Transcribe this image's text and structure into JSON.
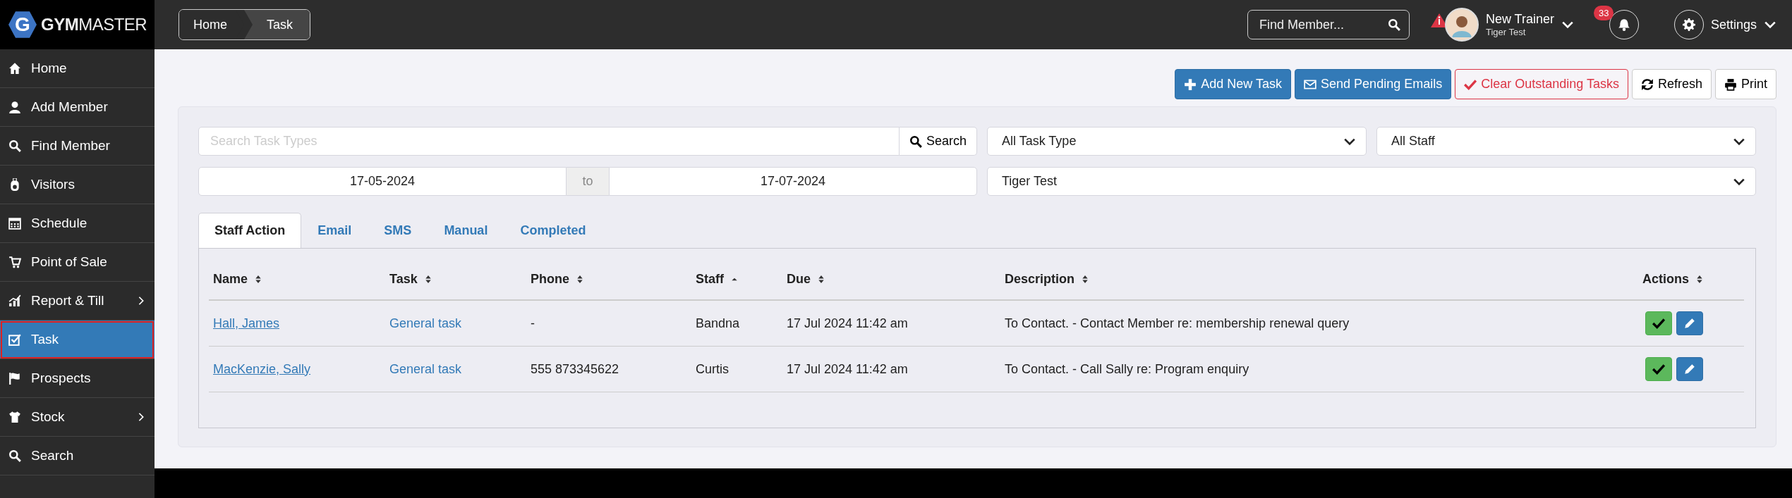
{
  "logo": {
    "mark": "G",
    "text": "**GYM**MASTER"
  },
  "breadcrumb": [
    "Home",
    "Task"
  ],
  "header": {
    "search": {
      "placeholder": "Find Member..."
    },
    "user": {
      "name": "New Trainer",
      "subtitle": "Tiger Test"
    },
    "notifications": {
      "count": "33"
    },
    "settings": {
      "label": "Settings"
    }
  },
  "sidebar": {
    "items": [
      {
        "label": "Home",
        "selected": false,
        "submenu": false
      },
      {
        "label": "Add Member",
        "selected": false,
        "submenu": false
      },
      {
        "label": "Find Member",
        "selected": false,
        "submenu": false
      },
      {
        "label": "Visitors",
        "selected": false,
        "submenu": false
      },
      {
        "label": "Schedule",
        "selected": false,
        "submenu": false
      },
      {
        "label": "Point of Sale",
        "selected": false,
        "submenu": false
      },
      {
        "label": "Report & Till",
        "selected": false,
        "submenu": true
      },
      {
        "label": "Task",
        "selected": true,
        "submenu": false
      },
      {
        "label": "Prospects",
        "selected": false,
        "submenu": false
      },
      {
        "label": "Stock",
        "selected": false,
        "submenu": true
      },
      {
        "label": "Search",
        "selected": false,
        "submenu": false
      }
    ]
  },
  "toolbar": [
    {
      "label": "Add New Task",
      "kind": "primary"
    },
    {
      "label": "Send Pending Emails",
      "kind": "primary"
    },
    {
      "label": "Clear Outstanding Tasks",
      "kind": "danger"
    },
    {
      "label": "Refresh",
      "kind": "default"
    },
    {
      "label": "Print",
      "kind": "default"
    }
  ],
  "filters": {
    "search": {
      "placeholder": "Search Task Types",
      "button": "Search"
    },
    "task_type": "All Task Type",
    "staff": "All Staff",
    "date_from": "17-05-2024",
    "date_separator": "to",
    "date_to": "17-07-2024",
    "assigned": "Tiger Test"
  },
  "tabs": [
    {
      "label": "Staff Action",
      "selected": true
    },
    {
      "label": "Email",
      "selected": false
    },
    {
      "label": "SMS",
      "selected": false
    },
    {
      "label": "Manual",
      "selected": false
    },
    {
      "label": "Completed",
      "selected": false
    }
  ],
  "table": {
    "columns": [
      {
        "label": "Name",
        "sorted": false
      },
      {
        "label": "Task",
        "sorted": false
      },
      {
        "label": "Phone",
        "sorted": false
      },
      {
        "label": "Staff",
        "sorted": true
      },
      {
        "label": "Due",
        "sorted": false
      },
      {
        "label": "Description",
        "sorted": false
      },
      {
        "label": "Actions",
        "sorted": false
      }
    ],
    "rows": [
      {
        "name": "Hall, James",
        "task": "General task",
        "phone": "-",
        "staff": "Bandna",
        "due": "17 Jul 2024 11:42 am",
        "description": "To Contact. - Contact Member re: membership renewal query"
      },
      {
        "name": "MacKenzie, Sally",
        "task": "General task",
        "phone": "555 873345622",
        "staff": "Curtis",
        "due": "17 Jul 2024 11:42 am",
        "description": "To Contact. - Call Sally re: Program enquiry"
      }
    ]
  }
}
